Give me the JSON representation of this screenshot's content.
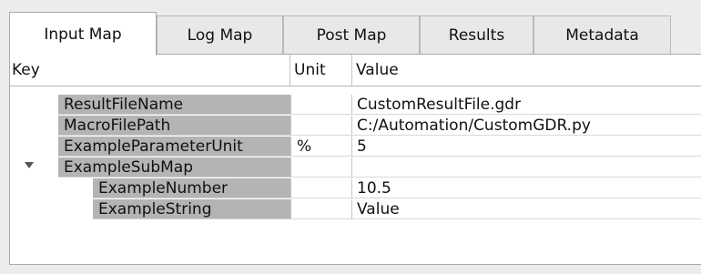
{
  "tabs": [
    {
      "label": "Input Map",
      "active": true
    },
    {
      "label": "Log Map",
      "active": false
    },
    {
      "label": "Post Map",
      "active": false
    },
    {
      "label": "Results",
      "active": false
    },
    {
      "label": "Metadata",
      "active": false
    }
  ],
  "table": {
    "columns": [
      "Key",
      "Unit",
      "Value"
    ],
    "rows": [
      {
        "key": "ResultFileName",
        "unit": "",
        "value": "CustomResultFile.gdr"
      },
      {
        "key": "MacroFilePath",
        "unit": "",
        "value": "C:/Automation/CustomGDR.py"
      },
      {
        "key": "ExampleParameterUnit",
        "unit": "%",
        "value": "5"
      },
      {
        "key": "ExampleSubMap",
        "unit": "",
        "value": "",
        "expanded": true
      },
      {
        "key": "ExampleNumber",
        "unit": "",
        "value": "10.5"
      },
      {
        "key": "ExampleString",
        "unit": "",
        "value": "Value"
      }
    ]
  },
  "colors": {
    "key_cell_bg": "#b4b4b4",
    "active_tab_bg": "#ffffff",
    "inactive_tab_bg": "#e8e8e8"
  },
  "icons": {
    "expander": "chevron-down-icon"
  }
}
